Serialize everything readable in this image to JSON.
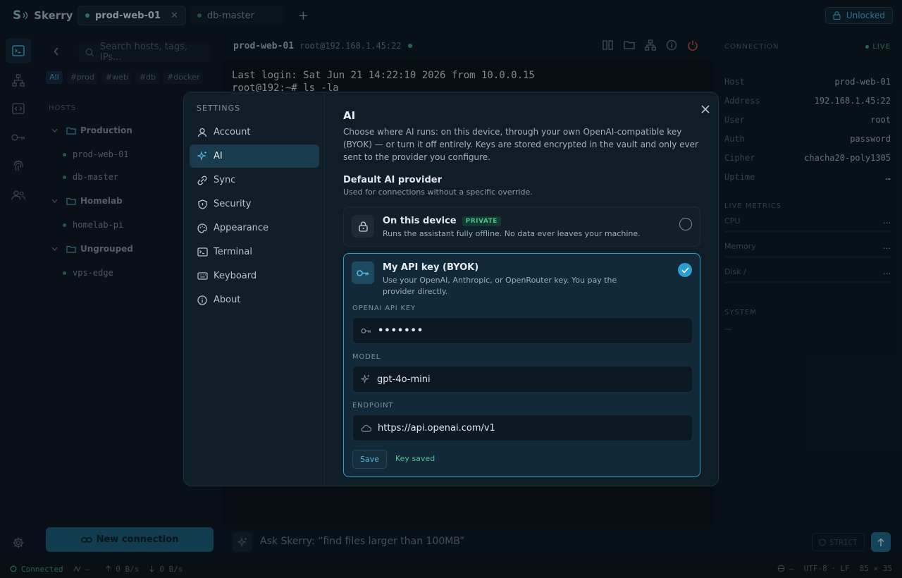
{
  "app": {
    "logo": "S",
    "name": "Skerry"
  },
  "tabs": [
    {
      "label": "prod-web-01",
      "active": true,
      "close": "✕"
    },
    {
      "label": "db-master",
      "active": false
    }
  ],
  "add_tab": "+",
  "unlock_label": "Unlocked",
  "sidebar": {
    "search_placeholder": "Search hosts, tags, IPs...",
    "tags": [
      "All",
      "#prod",
      "#web",
      "#db",
      "#docker"
    ],
    "hosts_label": "HOSTS",
    "groups": [
      {
        "name": "Production",
        "hosts": [
          "prod-web-01",
          "db-master"
        ]
      },
      {
        "name": "Homelab",
        "hosts": [
          "homelab-pi"
        ]
      },
      {
        "name": "Ungrouped",
        "hosts": [
          "vps-edge"
        ]
      }
    ],
    "new_connection": "New connection"
  },
  "terminal": {
    "host": "prod-web-01",
    "user_host": "root@192.168.1.45:22",
    "lines": [
      "Last login: Sat Jun 21 14:22:10 2026 from 10.0.0.15",
      "root@192:~# ls -la"
    ]
  },
  "ask": {
    "placeholder": "Ask Skerry: “find files larger than 100MB”",
    "strict": "STRICT"
  },
  "status": {
    "connected": "Connected",
    "latency": "—",
    "up": "0 B/s",
    "down": "0 B/s",
    "right": [
      "—",
      "UTF-8",
      "·",
      "LF",
      "85 × 35"
    ]
  },
  "connection": {
    "title": "CONNECTION",
    "live": "LIVE",
    "rows": [
      {
        "k": "Host",
        "v": "prod-web-01"
      },
      {
        "k": "Address",
        "v": "192.168.1.45:22"
      },
      {
        "k": "User",
        "v": "root"
      },
      {
        "k": "Auth",
        "v": "password"
      },
      {
        "k": "Cipher",
        "v": "chacha20-poly1305"
      },
      {
        "k": "Uptime",
        "v": "…"
      }
    ],
    "metrics_title": "LIVE METRICS",
    "metrics": [
      {
        "k": "CPU",
        "v": "…"
      },
      {
        "k": "Memory",
        "v": "…"
      },
      {
        "k": "Disk /",
        "v": "…"
      }
    ],
    "system_title": "SYSTEM",
    "system_value": "—"
  },
  "settings": {
    "title": "SETTINGS",
    "nav": [
      "Account",
      "AI",
      "Sync",
      "Security",
      "Appearance",
      "Terminal",
      "Keyboard",
      "About"
    ],
    "active_nav": "AI",
    "heading": "AI",
    "description": "Choose where AI runs: on this device, through your own OpenAI-compatible key (BYOK) — or turn it off entirely. Keys are stored encrypted in the vault and only ever sent to the provider you configure.",
    "provider_heading": "Default AI provider",
    "provider_sub": "Used for connections without a specific override.",
    "options": [
      {
        "title": "On this device",
        "badge": "PRIVATE",
        "desc": "Runs the assistant fully offline. No data ever leaves your machine.",
        "selected": false
      },
      {
        "title": "My API key (BYOK)",
        "desc": "Use your OpenAI, Anthropic, or OpenRouter key. You pay the provider directly.",
        "selected": true
      }
    ],
    "fields": {
      "api_key_label": "OPENAI API KEY",
      "api_key_value": "•••••••",
      "model_label": "MODEL",
      "model_value": "gpt-4o-mini",
      "endpoint_label": "ENDPOINT",
      "endpoint_value": "https://api.openai.com/v1"
    },
    "save": "Save",
    "save_status": "Key saved"
  },
  "colors": {
    "accent": "#2ea2c7",
    "success": "#4cc392",
    "background": "#0c1620"
  }
}
